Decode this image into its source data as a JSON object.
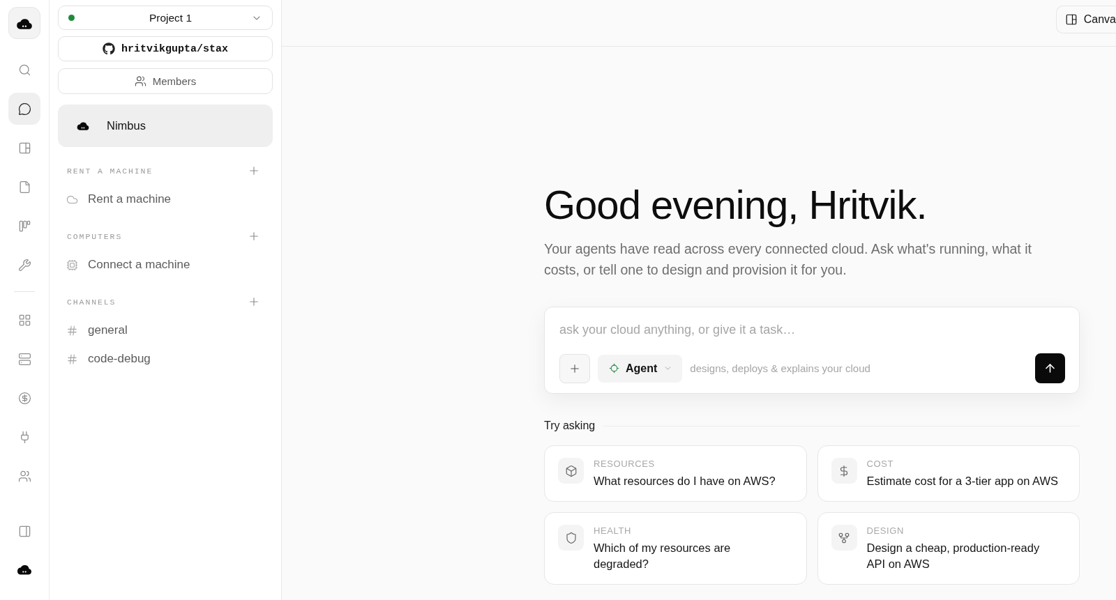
{
  "rail": {
    "top": [
      {
        "selected": false
      },
      {
        "selected": true
      },
      {
        "selected": false
      },
      {
        "selected": false
      },
      {
        "selected": false
      },
      {
        "selected": false
      }
    ],
    "middle": [
      {
        "selected": false
      },
      {
        "selected": false
      },
      {
        "selected": false
      },
      {
        "selected": false
      },
      {
        "selected": false
      }
    ],
    "bottom": [
      {
        "selected": false
      },
      {
        "selected": false
      }
    ]
  },
  "sidebar": {
    "project": {
      "name": "Project 1",
      "online": true
    },
    "repository": {
      "name": "hritvikgupta/stax"
    },
    "members": {
      "label": "Members"
    },
    "agent": {
      "name": "Nimbus",
      "selected": true
    },
    "sections": [
      {
        "title": "RENT A MACHINE",
        "items": [
          {
            "kind": "rent",
            "label": "Rent a machine",
            "selected": false
          }
        ]
      },
      {
        "title": "COMPUTERS",
        "items": [
          {
            "kind": "computer",
            "label": "Connect a machine",
            "selected": false
          }
        ]
      },
      {
        "title": "CHANNELS",
        "items": [
          {
            "kind": "channel",
            "label": "general",
            "selected": false
          },
          {
            "kind": "channel",
            "label": "code-debug",
            "selected": false
          }
        ]
      }
    ]
  },
  "header": {
    "canvas_button": {
      "label": "Canva"
    }
  },
  "greeting": {
    "title": "Good evening, Hritvik.",
    "subtitle": "Your agents have read across every connected cloud. Ask what's running, what it costs, or tell one to design and provision it for you."
  },
  "composer": {
    "placeholder": "ask your cloud anything, or give it a task…",
    "mode": "Agent",
    "mode_hint": "designs, deploys & explains your cloud"
  },
  "suggestions": {
    "title": "Try asking",
    "items": [
      {
        "kind": "resources",
        "category": "RESOURCES",
        "question": "What resources do I have on AWS?"
      },
      {
        "kind": "cost",
        "category": "COST",
        "question": "Estimate cost for a 3-tier app on AWS"
      },
      {
        "kind": "health",
        "category": "HEALTH",
        "question": "Which of my resources are degraded?"
      },
      {
        "kind": "design",
        "category": "DESIGN",
        "question": "Design a cheap, production-ready API on AWS"
      }
    ]
  }
}
